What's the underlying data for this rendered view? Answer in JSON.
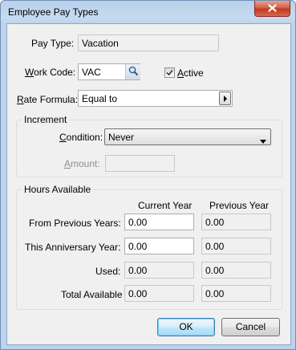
{
  "window": {
    "title": "Employee Pay Types"
  },
  "fields": {
    "pay_type": {
      "label": "Pay Type:",
      "value": "Vacation"
    },
    "work_code": {
      "label": "Work Code:",
      "value": "VAC"
    },
    "active": {
      "label": "Active",
      "checked": true
    },
    "rate_formula": {
      "label": "Rate Formula:",
      "value": "Equal to"
    }
  },
  "increment": {
    "title": "Increment",
    "condition_label": "Condition:",
    "condition_value": "Never",
    "amount_label": "Amount:",
    "amount_value": ""
  },
  "hours": {
    "title": "Hours Available",
    "col_current": "Current Year",
    "col_previous": "Previous Year",
    "rows": [
      {
        "label": "From Previous Years:",
        "current": "0.00",
        "previous": "0.00"
      },
      {
        "label": "This Anniversary Year:",
        "current": "0.00",
        "previous": "0.00"
      },
      {
        "label": "Used:",
        "current": "0.00",
        "previous": "0.00"
      },
      {
        "label": "Total Available",
        "current": "0.00",
        "previous": "0.00"
      }
    ]
  },
  "buttons": {
    "ok": "OK",
    "cancel": "Cancel"
  },
  "icons": {
    "close": "close-icon",
    "lookup": "magnifier-icon",
    "arrow": "arrow-right-icon",
    "dropdown": "chevron-down-icon",
    "check": "checkmark-icon"
  }
}
